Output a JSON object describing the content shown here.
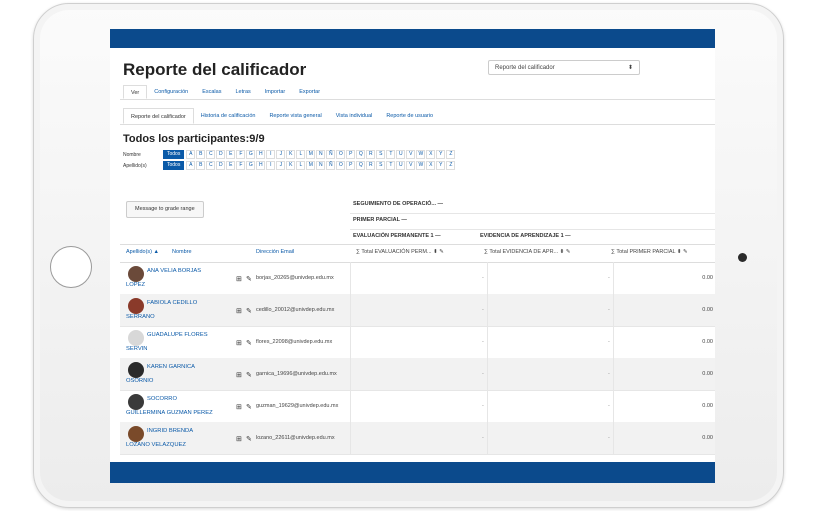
{
  "page": {
    "title": "Reporte del calificador",
    "select_value": "Reporte del calificador",
    "tabs": [
      "Ver",
      "Configuración",
      "Escalas",
      "Letras",
      "Importar",
      "Exportar"
    ],
    "subtabs": [
      "Reporte del calificador",
      "Historia de calificación",
      "Reporte vista general",
      "Vista individual",
      "Reporte de usuario"
    ],
    "subtitle": "Todos los participantes:9/9",
    "filter_name_label": "Nombre",
    "filter_surname_label": "Apellido(s)",
    "filter_all_name": "Todos",
    "filter_all_surname": "Todos",
    "letters": [
      "A",
      "B",
      "C",
      "D",
      "E",
      "F",
      "G",
      "H",
      "I",
      "J",
      "K",
      "L",
      "M",
      "N",
      "Ñ",
      "O",
      "P",
      "Q",
      "R",
      "S",
      "T",
      "U",
      "V",
      "W",
      "X",
      "Y",
      "Z"
    ],
    "message_button": "Message to grade range"
  },
  "grid": {
    "cat1": "SEGUIMIENTO DE OPERACIÓ... —",
    "cat2": "PRIMER PARCIAL —",
    "cat3": "EVALUACIÓN PERMANENTE 1 —",
    "cat4": "EVIDENCIA DE APRENDIZAJE 1 —",
    "col_surname": "Apellido(s) ▲",
    "col_name": "Nombre",
    "col_email": "Dirección Email",
    "col_total1": "Total EVALUACIÓN PERM...",
    "col_total2": "Total EVIDENCIA DE APR...",
    "col_total3": "Total PRIMER PARCIAL",
    "students": [
      {
        "first": "ANA VELIA BORJAS",
        "second": "LOPEZ",
        "email": "borjas_20265@univdep.edu.mx",
        "t1": "-",
        "t2": "-",
        "t3": "0.00",
        "color": "#6b4a3a"
      },
      {
        "first": "FABIOLA CEDILLO",
        "second": "SERRANO",
        "email": "cedillo_20012@univdep.edu.mx",
        "t1": "-",
        "t2": "-",
        "t3": "0.00",
        "color": "#8a3a2a"
      },
      {
        "first": "GUADALUPE FLORES",
        "second": "SERVIN",
        "email": "flores_22098@univdep.edu.mx",
        "t1": "-",
        "t2": "-",
        "t3": "0.00",
        "color": "#d8d8d8"
      },
      {
        "first": "KAREN GARNICA",
        "second": "OSORNIO",
        "email": "garnica_19696@univdep.edu.mx",
        "t1": "-",
        "t2": "-",
        "t3": "0.00",
        "color": "#2a2a2a"
      },
      {
        "first": "SOCORRO",
        "second": "GUILLERMINA GUZMAN PEREZ",
        "email": "guzman_19629@univdep.edu.mx",
        "t1": "-",
        "t2": "-",
        "t3": "0.00",
        "color": "#3a3a3a"
      },
      {
        "first": "INGRID BRENDA",
        "second": "LOZANO VELAZQUEZ",
        "email": "lozano_22611@univdep.edu.mx",
        "t1": "-",
        "t2": "-",
        "t3": "0.00",
        "color": "#7a4a2a"
      }
    ]
  }
}
